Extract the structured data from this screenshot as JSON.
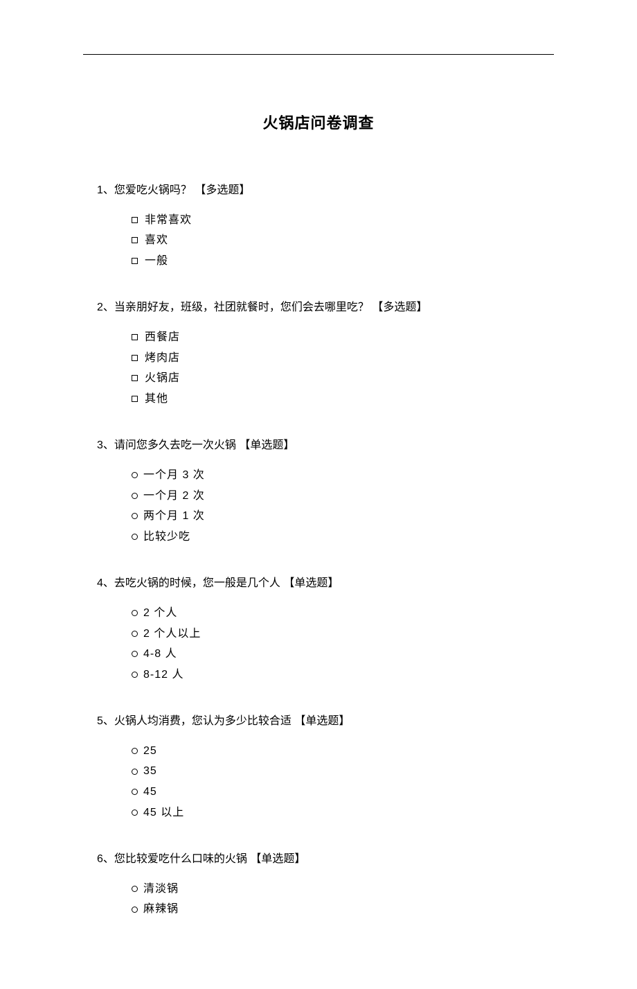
{
  "title": "火锅店问卷调查",
  "questions": [
    {
      "number": "1、",
      "text": "您爱吃火锅吗？ 【多选题】",
      "type": "checkbox",
      "options": [
        "非常喜欢",
        "喜欢",
        "一般"
      ]
    },
    {
      "number": "2、",
      "text": "当亲朋好友，班级，社团就餐时，您们会去哪里吃？ 【多选题】",
      "type": "checkbox",
      "options": [
        "西餐店",
        "烤肉店",
        "火锅店",
        "其他"
      ]
    },
    {
      "number": "3、",
      "text": "请问您多久去吃一次火锅 【单选题】",
      "type": "radio",
      "options": [
        "一个月 3 次",
        "一个月 2 次",
        "两个月 1 次",
        "比较少吃"
      ]
    },
    {
      "number": "4、",
      "text": "去吃火锅的时候，您一般是几个人 【单选题】",
      "type": "radio",
      "options": [
        "2 个人",
        "2 个人以上",
        "4-8 人",
        "8-12 人"
      ]
    },
    {
      "number": "5、",
      "text": "火锅人均消费，您认为多少比较合适 【单选题】",
      "type": "radio",
      "options": [
        "25",
        "35",
        "45",
        "45 以上"
      ]
    },
    {
      "number": "6、",
      "text": "您比较爱吃什么口味的火锅 【单选题】",
      "type": "radio",
      "options": [
        "清淡锅",
        "麻辣锅"
      ]
    }
  ]
}
